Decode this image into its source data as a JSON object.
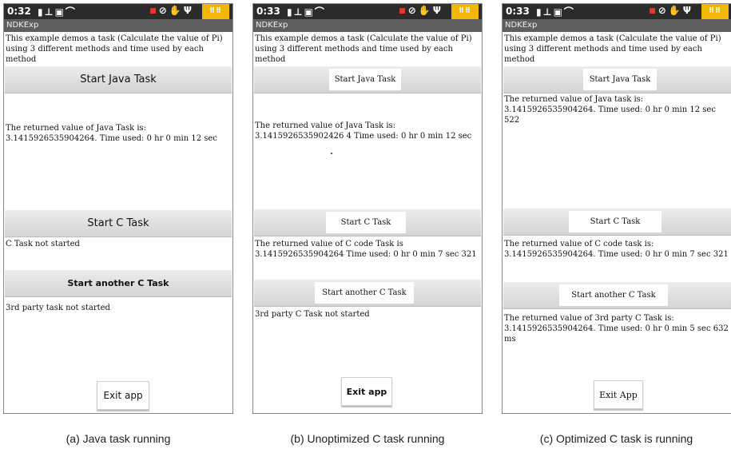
{
  "status_icons": [
    "sim-icon",
    "signal-icon",
    "photo-icon",
    "wifi-icon",
    "alert-icon",
    "shield-icon",
    "hand-icon",
    "usb-icon",
    "app-grid-icon"
  ],
  "screens": [
    {
      "time": "0:32",
      "app_title": "NDKExp",
      "description": "This example demos a task (Calculate the value of Pi) using 3 different methods and time used by each method",
      "java_button": "Start Java Task",
      "java_result": "The returned value of Java Task is: 3.1415926535904264. Time used: 0 hr 0 min 12 sec",
      "c_button": "Start C Task",
      "c_result": "C Task not started",
      "another_button": "Start another C Task",
      "another_result": "3rd party task not started",
      "exit_button": "Exit app",
      "caption": "(a) Java task running"
    },
    {
      "time": "0:33",
      "app_title": "NDKExp",
      "description": "This example demos a task (Calculate the value of Pi) using 3 different methods and time used by each method",
      "java_button": "Start Java Task",
      "java_result": "The returned value of Java Task is: 3.1415926535902426 4 Time used: 0 hr 0 min 12 sec",
      "c_button": "Start C Task",
      "c_result": "The returned value of C code Task is 3.1415926535904264 Time used: 0 hr 0 min 7 sec 321",
      "another_button": "Start another C Task",
      "another_result": "3rd party C Task not started",
      "exit_button": "Exit app",
      "caption": "(b) Unoptimized C task running"
    },
    {
      "time": "0:33",
      "app_title": "NDKExp",
      "description": "This example demos a task (Calculate the value of Pi) using 3 different methods and time used by each method",
      "java_button": "Start Java Task",
      "java_result": "The returned value of Java task is: 3.1415926535904264. Time used: 0 hr 0 min 12 sec 522",
      "c_button": "Start C Task",
      "c_result": "The returned value of C code task is: 3.1415926535904264. Time used: 0 hr 0 min 7 sec 321",
      "another_button": "Start another C Task",
      "another_result": "The returned value of 3rd party C Task is: 3.1415926535904264. Time used: 0 hr 0 min 5 sec 632 ms",
      "exit_button": "Exit App",
      "caption": "(c) Optimized C task is running"
    }
  ]
}
